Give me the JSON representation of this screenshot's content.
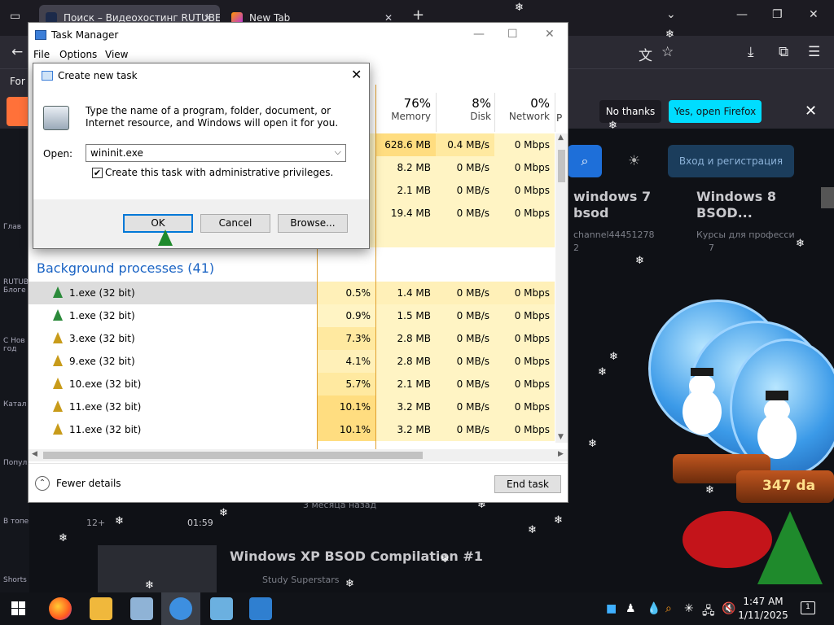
{
  "browser": {
    "tabs": [
      {
        "label": "Поиск – Видеохостинг RUTUBE"
      },
      {
        "label": "New Tab"
      }
    ],
    "notification": {
      "leading_text": "For c",
      "no_thanks": "No thanks",
      "yes_open": "Yes, open Firefox"
    },
    "page": {
      "register_button": "Вход и регистрация",
      "sidebar": [
        "Глав",
        "RUTUBE Блоге",
        "С Нов год",
        "Катал",
        "Популя",
        "В топе",
        "Shorts"
      ],
      "videos": [
        {
          "title": "windows 7 bsod",
          "channel": "channel44451278",
          "views": "2"
        },
        {
          "title": "Windows 8 BSOD...",
          "channel": "Курсы для професси",
          "views": "7"
        },
        {
          "title": "Windows XP BSOD Compilation #1",
          "channel": "Study Superstars",
          "duration": "01:59",
          "age": "3 месяца назад",
          "tag": "12+"
        }
      ]
    }
  },
  "task_manager": {
    "title": "Task Manager",
    "menu": [
      "File",
      "Options",
      "View"
    ],
    "columns": [
      {
        "pct": "76%",
        "name": "Memory"
      },
      {
        "pct": "8%",
        "name": "Disk"
      },
      {
        "pct": "0%",
        "name": "Network"
      },
      {
        "pct": "",
        "name": "P"
      }
    ],
    "top_rows": [
      {
        "cpu": "",
        "memory": "628.6 MB",
        "disk": "0.4 MB/s",
        "network": "0 Mbps"
      },
      {
        "cpu": "",
        "memory": "8.2 MB",
        "disk": "0 MB/s",
        "network": "0 Mbps"
      },
      {
        "cpu": "",
        "memory": "2.1 MB",
        "disk": "0 MB/s",
        "network": "0 Mbps"
      },
      {
        "cpu": "",
        "memory": "19.4 MB",
        "disk": "0 MB/s",
        "network": "0 Mbps"
      }
    ],
    "group_header": "Background processes (41)",
    "processes": [
      {
        "name": "1.exe (32 bit)",
        "cpu": "0.5%",
        "memory": "1.4 MB",
        "disk": "0 MB/s",
        "network": "0 Mbps"
      },
      {
        "name": "1.exe (32 bit)",
        "cpu": "0.9%",
        "memory": "1.5 MB",
        "disk": "0 MB/s",
        "network": "0 Mbps"
      },
      {
        "name": "3.exe (32 bit)",
        "cpu": "7.3%",
        "memory": "2.8 MB",
        "disk": "0 MB/s",
        "network": "0 Mbps"
      },
      {
        "name": "9.exe (32 bit)",
        "cpu": "4.1%",
        "memory": "2.8 MB",
        "disk": "0 MB/s",
        "network": "0 Mbps"
      },
      {
        "name": "10.exe (32 bit)",
        "cpu": "5.7%",
        "memory": "2.1 MB",
        "disk": "0 MB/s",
        "network": "0 Mbps"
      },
      {
        "name": "11.exe (32 bit)",
        "cpu": "10.1%",
        "memory": "3.2 MB",
        "disk": "0 MB/s",
        "network": "0 Mbps"
      },
      {
        "name": "11.exe (32 bit)",
        "cpu": "10.1%",
        "memory": "3.2 MB",
        "disk": "0 MB/s",
        "network": "0 Mbps"
      }
    ],
    "fewer_details": "Fewer details",
    "end_task": "End task"
  },
  "run_dialog": {
    "title": "Create new task",
    "description": "Type the name of a program, folder, document, or Internet resource, and Windows will open it for you.",
    "open_label": "Open:",
    "open_value": "wininit.exe",
    "admin_label": "Create this task with administrative privileges.",
    "admin_checked": true,
    "ok": "OK",
    "cancel": "Cancel",
    "browse": "Browse..."
  },
  "globe_text": "347 da",
  "taskbar": {
    "time": "1:47 AM",
    "date": "1/11/2025",
    "notification_count": "1"
  },
  "colors": {
    "heat_light": "#fff4c4",
    "heat_mid": "#ffe9a0",
    "heat_strong": "#ffdd80",
    "accent_blue": "#1b64c4",
    "firefox_button": "#00ddff"
  }
}
